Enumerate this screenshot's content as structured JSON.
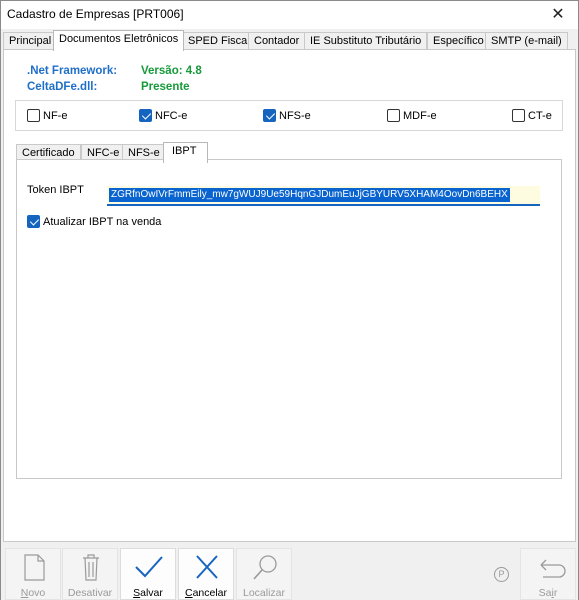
{
  "window": {
    "title": "Cadastro de Empresas [PRT006]",
    "close_glyph": "✕"
  },
  "main_tabs": [
    {
      "label": "Principal",
      "active": false
    },
    {
      "label": "Documentos Eletrônicos",
      "active": true
    },
    {
      "label": "SPED Fiscal",
      "active": false
    },
    {
      "label": "Contador",
      "active": false
    },
    {
      "label": "IE Substituto Tributário",
      "active": false
    },
    {
      "label": "Específico",
      "active": false
    },
    {
      "label": "SMTP (e-mail)",
      "active": false
    }
  ],
  "info": {
    "net_label": ".Net Framework:",
    "net_value": "Versão: 4.8",
    "dll_label": "CeltaDFe.dll:",
    "dll_value": "Presente"
  },
  "documents": [
    {
      "label": "NF-e",
      "checked": false
    },
    {
      "label": "NFC-e",
      "checked": true
    },
    {
      "label": "NFS-e",
      "checked": true
    },
    {
      "label": "MDF-e",
      "checked": false
    },
    {
      "label": "CT-e",
      "checked": false
    }
  ],
  "inner_tabs": [
    {
      "label": "Certificado",
      "active": false
    },
    {
      "label": "NFC-e",
      "active": false
    },
    {
      "label": "NFS-e",
      "active": false
    },
    {
      "label": "IBPT",
      "active": true
    }
  ],
  "ibpt": {
    "token_label": "Token IBPT",
    "token_value": "ZGRfnOwIVrFmmEily_mw7gWUJ9Ue59HqnGJDumEuJjGBYURV5XHAM4OovDn6BEHX",
    "update_label": "Atualizar IBPT na venda",
    "update_checked": true
  },
  "toolbar": {
    "novo": "Novo",
    "desativar": "Desativar",
    "salvar": "Salvar",
    "cancelar": "Cancelar",
    "localizar": "Localizar",
    "sair": "Sair",
    "p_badge": "P"
  },
  "colors": {
    "accent": "#1565c0",
    "info_blue": "#1f6fc9",
    "info_green": "#179a3a"
  }
}
